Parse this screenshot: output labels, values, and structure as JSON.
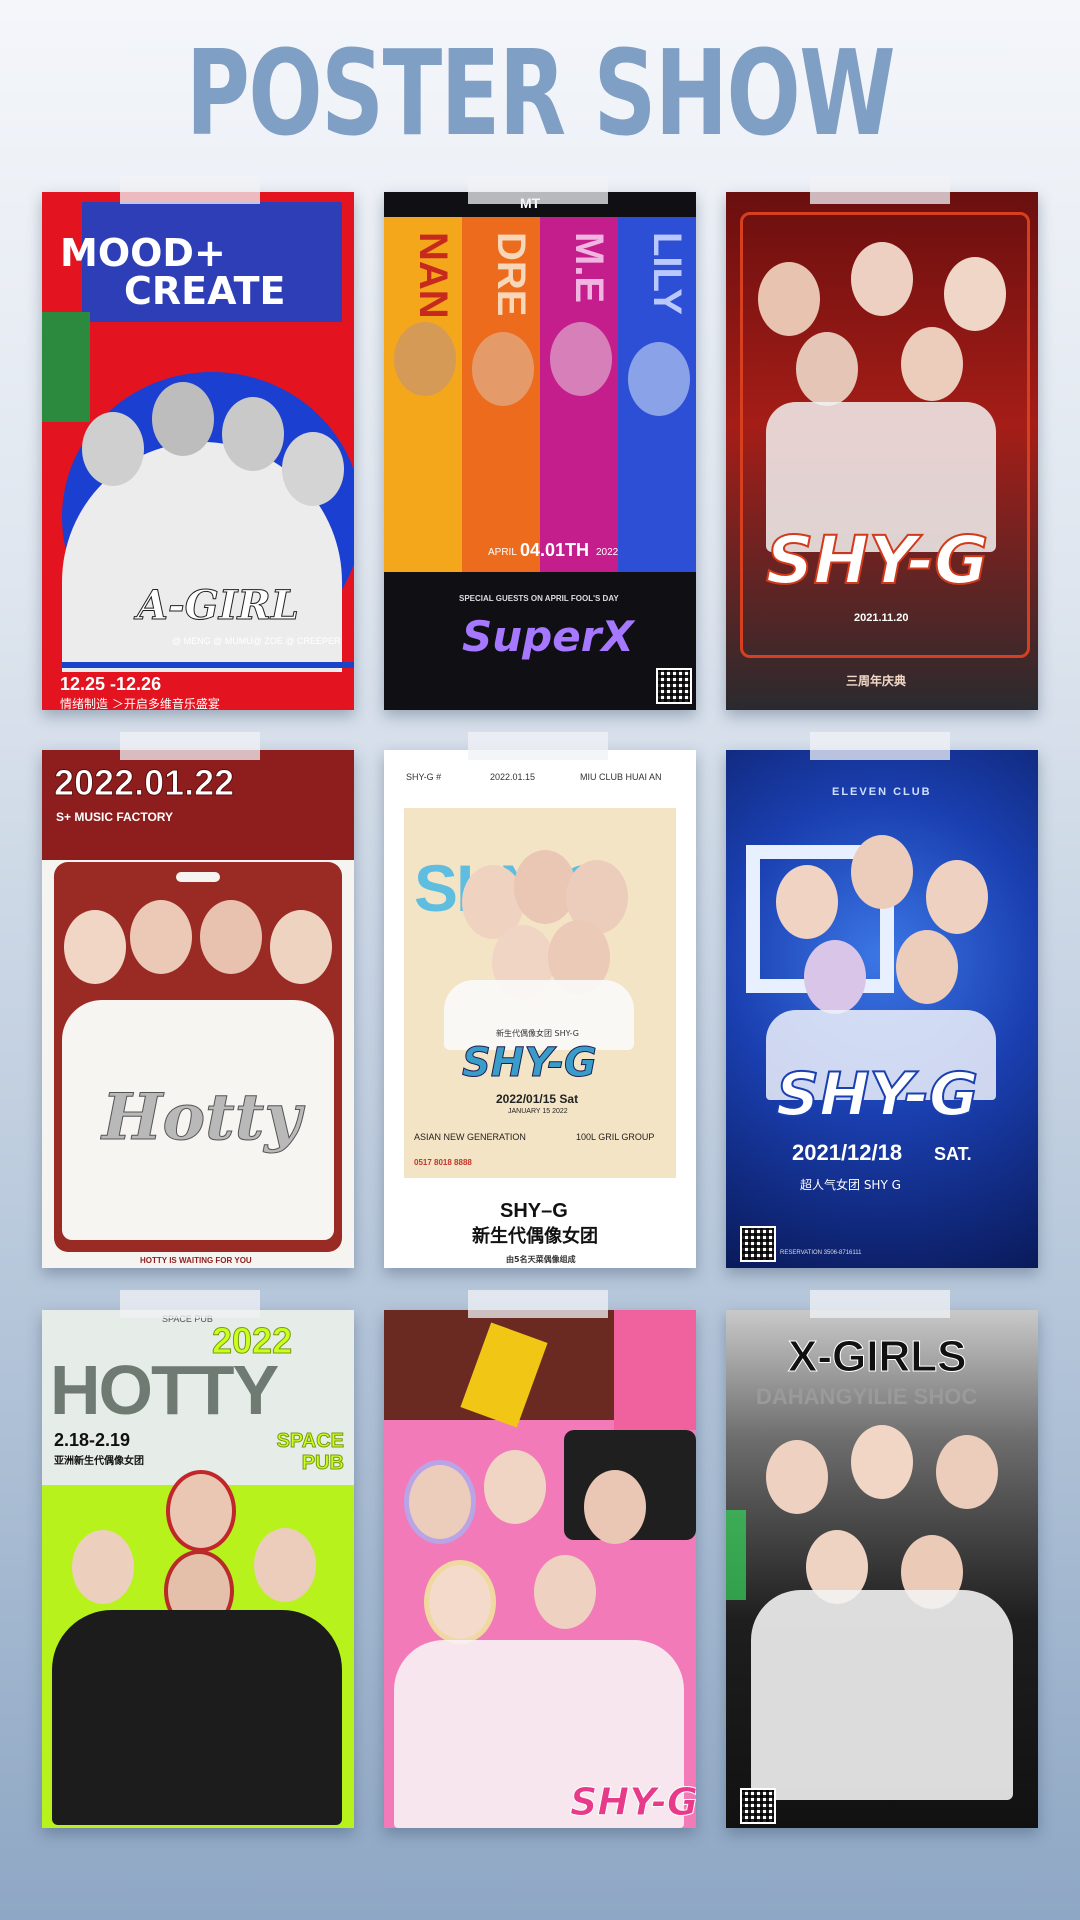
{
  "page": {
    "title": "POSTER SHOW"
  },
  "posters": [
    {
      "name": "mood-create",
      "headline_1": "MOOD+",
      "headline_2": "CREATE",
      "script": "A-GIRL",
      "members": "@ MENG @ MUMU@ ZOE @ CREEPER",
      "dates": "12.25 -12.26",
      "tagline": "情绪制造 ＞开启多维音乐盛宴"
    },
    {
      "name": "super-x",
      "club": "MT",
      "stripes": [
        "NAN",
        "DRE",
        "M.E",
        "LILY"
      ],
      "date_prefix": "APRIL",
      "date_main": "04.01TH",
      "year": "2022",
      "guests": "SPECIAL GUESTS ON APRIL FOOL'S DAY",
      "brand": "SuperX"
    },
    {
      "name": "shy-g-anniversary",
      "brand": "SHY-G",
      "date": "2021.11.20",
      "caption": "三周年庆典"
    },
    {
      "name": "hotty-music-factory",
      "date": "2022.01.22",
      "venue": "S+ MUSIC FACTORY",
      "script": "Hotty",
      "footer": "HOTTY IS WAITING FOR YOU"
    },
    {
      "name": "shy-g-miu-club",
      "top_left": "SHY-G #",
      "top_mid": "2022.01.15",
      "top_right": "MIU CLUB   HUAI AN",
      "brand": "SHY-G",
      "cn_line": "新生代偶像女团 SHY-G",
      "date": "2022/01/15 Sat",
      "date_en": "JANUARY 15 2022",
      "left_line": "ASIAN NEW GENERATION",
      "right_line": "100L GRIL GROUP",
      "phone": "0517 8018 8888",
      "bottom_title": "SHY–G",
      "bottom_subtitle": "新生代偶像女团",
      "bottom_note": "由5名天菜偶像组成"
    },
    {
      "name": "shy-g-eleven-club",
      "club": "ELEVEN CLUB",
      "brand": "SHY-G",
      "date": "2021/12/18",
      "weekday": "SAT.",
      "caption": "超人气女团  SHY G",
      "reservation": "RESERVATION 3506-8716111"
    },
    {
      "name": "hotty-space-pub",
      "venue_top": "SPACE PUB",
      "year": "2022",
      "headline": "HOTTY",
      "dates": "2.18-2.19",
      "venue": "SPACE PUB",
      "cn_line": "亚洲新生代偶像女团"
    },
    {
      "name": "shy-g-pink",
      "brand": "SHY-G"
    },
    {
      "name": "x-girls",
      "brand": "X-GIRLS",
      "subtitle": "DAHANGYILIE SHOC"
    }
  ]
}
